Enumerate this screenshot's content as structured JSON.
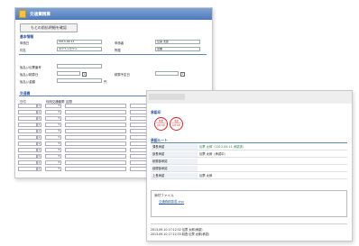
{
  "form": {
    "title": "交通費精算",
    "back_button": "もとの前払明細を確認",
    "section_basic": "基本情報",
    "fields": [
      {
        "label": "申請日",
        "value": "2013-09-11"
      },
      {
        "label": "申請者",
        "value": "伝票 太郎"
      },
      {
        "label": "件名",
        "value": "ネクストセクト"
      },
      {
        "label": "所属",
        "value": "営業"
      }
    ],
    "fields2": [
      {
        "label": "仮払い伝票番号",
        "value": ""
      },
      {
        "label": "仮払い精算日",
        "value": ""
      },
      {
        "label": "精算予定日",
        "value": ""
      },
      {
        "label": "仮払い金額",
        "value": "",
        "unit": "円"
      }
    ],
    "section_detail": "交通費",
    "columns": [
      "日付",
      "利用交通機関",
      "区間"
    ],
    "row_count": 12,
    "calendar_glyph": "▾",
    "dropdown_glyph": "▾"
  },
  "detail": {
    "section_approval": "承認印",
    "stamps": [
      {
        "line1": "精算",
        "line2": "2013-09-10",
        "line3": "伝票 太郎"
      },
      {
        "line1": "承認",
        "line2": "2013-09-10",
        "line3": "伝票 太郎"
      }
    ],
    "section_route": "承認ルート",
    "rows": [
      {
        "key": "課長承認",
        "value": "伝票 太郎（2013-09-11 承認済）",
        "highlight": true
      },
      {
        "key": "部長承認",
        "value": "伝票 太郎（承認中）",
        "highlight": false
      },
      {
        "key": "総務部承認",
        "value": "",
        "highlight": false
      },
      {
        "key": "経理部承認",
        "value": "",
        "highlight": false
      },
      {
        "key": "上長承認",
        "value": "伝票 太郎",
        "highlight": false
      }
    ],
    "attachment_label": "添付ファイル",
    "attachment_file": "交通費精算書.xlsx",
    "log": [
      "2013-09-10 17:12:32 伝票 太郎(承認)",
      "2013-09-10 17:12:33 精査 伝票 太郎(承認)"
    ]
  },
  "colors": {
    "titlebar": "#5a82c0",
    "section": "#2a56a8",
    "stamp": "#dd2222",
    "approved": "#1b8a3a",
    "link": "#2255aa"
  }
}
